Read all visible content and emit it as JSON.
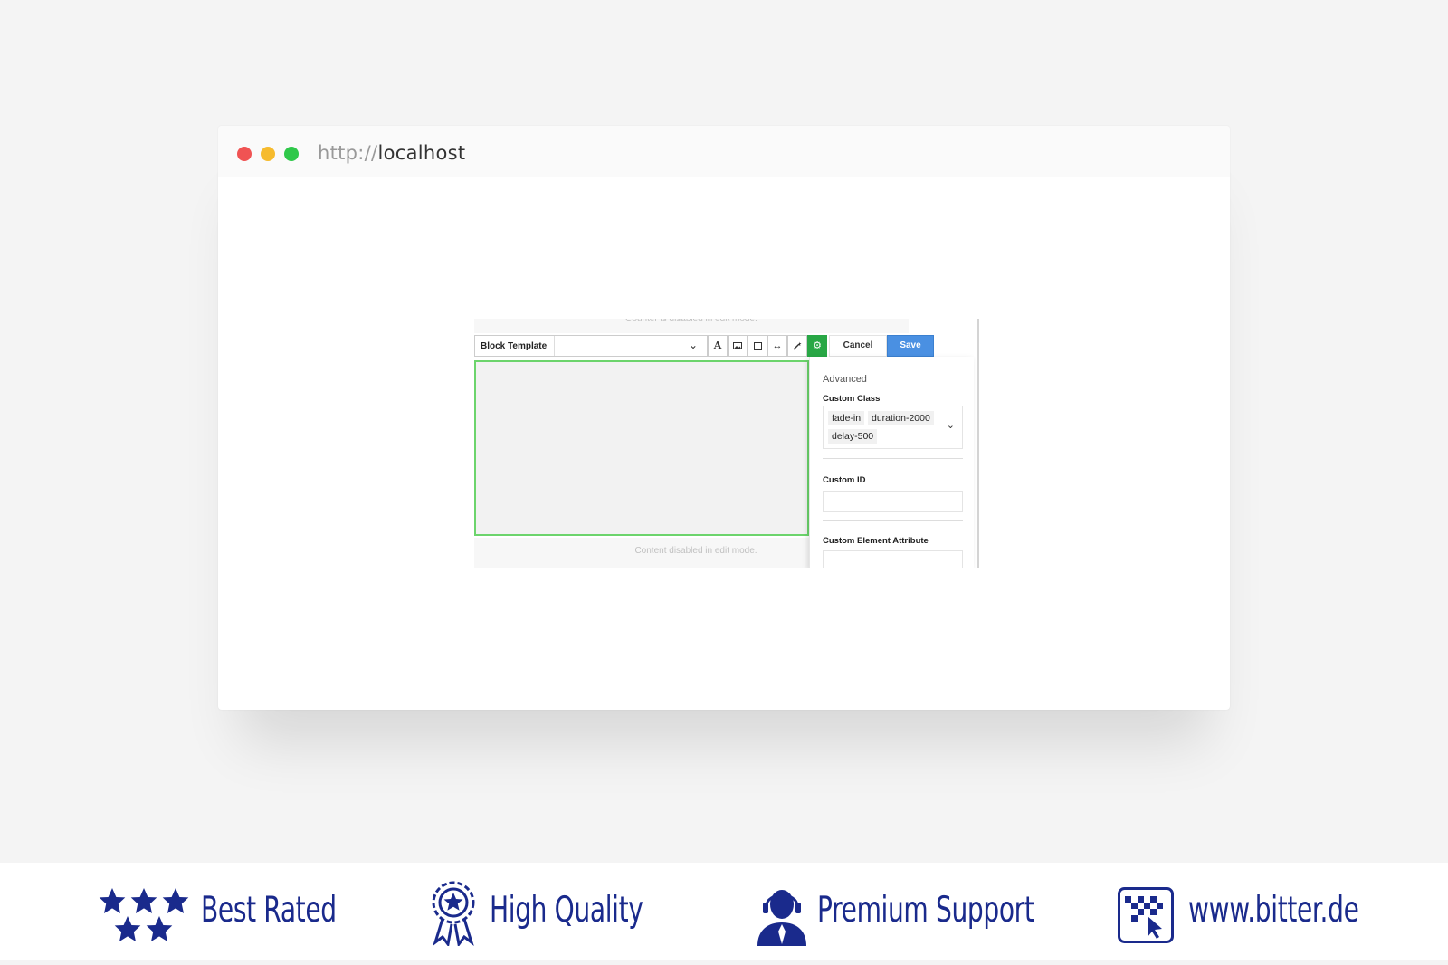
{
  "browser": {
    "url_protocol": "http://",
    "url_host": "localhost"
  },
  "editor": {
    "disabled_top_text": "Counter is disabled in edit mode.",
    "disabled_bottom_text": "Content disabled in edit mode.",
    "toolbar": {
      "select_label": "Block Template",
      "cancel_label": "Cancel",
      "save_label": "Save"
    },
    "panel": {
      "heading": "Advanced",
      "custom_class_label": "Custom Class",
      "custom_class_tags": [
        "fade-in",
        "duration-2000",
        "delay-500"
      ],
      "custom_id_label": "Custom ID",
      "custom_id_value": "",
      "custom_attr_label": "Custom Element Attribute",
      "custom_attr_value": ""
    }
  },
  "banner": {
    "features": [
      {
        "label": "Best Rated",
        "icon": "stars-icon"
      },
      {
        "label": "High Quality",
        "icon": "award-ribbon-icon"
      },
      {
        "label": "Premium Support",
        "icon": "support-agent-icon"
      },
      {
        "label": "www.bitter.de",
        "icon": "bitter-logo-icon"
      }
    ],
    "color": "#1a2a8c"
  },
  "colors": {
    "accent_save": "#4a90e2",
    "accent_settings": "#28a745",
    "content_border": "#6cd46c"
  }
}
